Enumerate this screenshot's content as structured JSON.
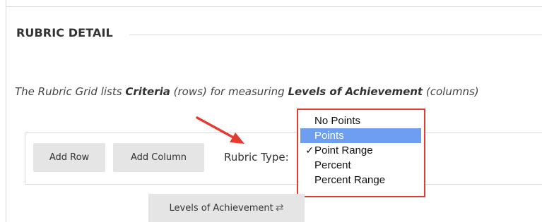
{
  "section": {
    "title": "RUBRIC DETAIL"
  },
  "intro": {
    "part1": "The Rubric Grid lists ",
    "criteria": "Criteria",
    "part2": " (rows) for measuring ",
    "levels": "Levels of Achievement",
    "part3": " (columns)"
  },
  "toolbar": {
    "add_row_label": "Add Row",
    "add_column_label": "Add Column",
    "rubric_type_label": "Rubric Type:"
  },
  "rubric_type_dropdown": {
    "options": [
      {
        "label": "No Points",
        "highlighted": false,
        "checked": false
      },
      {
        "label": "Points",
        "highlighted": true,
        "checked": false
      },
      {
        "label": "Point Range",
        "highlighted": false,
        "checked": true
      },
      {
        "label": "Percent",
        "highlighted": false,
        "checked": false
      },
      {
        "label": "Percent Range",
        "highlighted": false,
        "checked": false
      }
    ],
    "check_glyph": "✓",
    "highlight_color": "#6d9eef",
    "annotation_color": "#e53a2f"
  },
  "levels_button": {
    "label": "Levels of Achievement",
    "icon": "swap-arrows-icon",
    "icon_glyph": "⇄"
  }
}
